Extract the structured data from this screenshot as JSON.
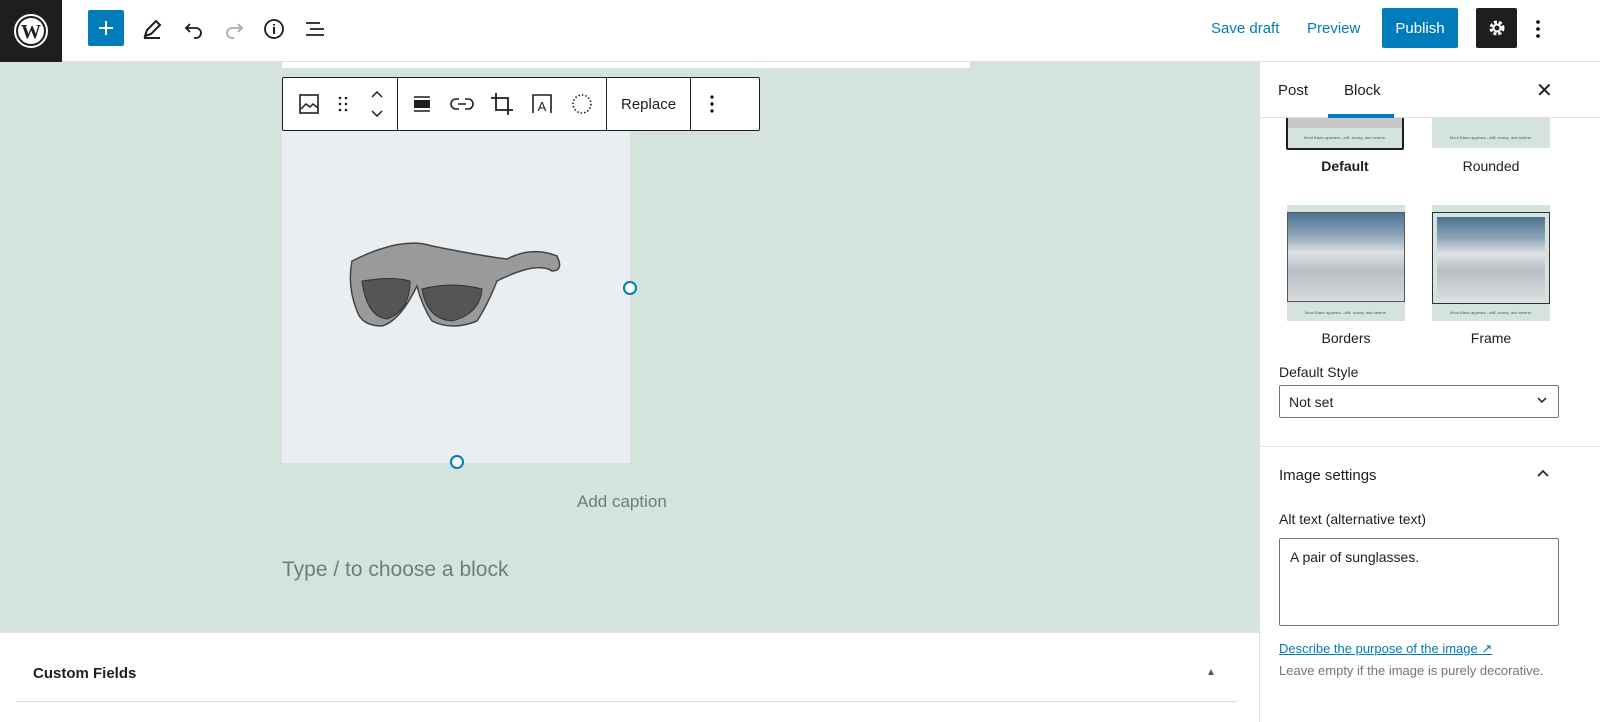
{
  "topbar": {
    "save_draft": "Save draft",
    "preview": "Preview",
    "publish": "Publish"
  },
  "accent": "#007cba",
  "toolbar": {
    "icons": [
      "image-icon",
      "drag-handle-icon",
      "move-up-down-icon",
      "align-icon",
      "link-icon",
      "crop-icon",
      "text-overlay-icon",
      "duotone-icon"
    ],
    "replace": "Replace"
  },
  "canvas": {
    "caption_placeholder": "Add caption",
    "block_placeholder": "Type / to choose a block",
    "image_alt": "A pair of sunglasses."
  },
  "custom_fields": {
    "title": "Custom Fields"
  },
  "sidebar": {
    "tabs": [
      {
        "label": "Post"
      },
      {
        "label": "Block",
        "active": true
      }
    ],
    "styles": [
      {
        "label": "Default",
        "selected": true
      },
      {
        "label": "Rounded"
      },
      {
        "label": "Borders"
      },
      {
        "label": "Frame"
      }
    ],
    "thumb_caption": "Mont Blanc appears—still, snowy, and serene.",
    "default_style_label": "Default Style",
    "default_style_value": "Not set",
    "image_settings": "Image settings",
    "alt_label": "Alt text (alternative text)",
    "alt_value": "A pair of sunglasses.",
    "alt_link": "Describe the purpose of the image",
    "alt_help": "Leave empty if the image is purely decorative."
  }
}
